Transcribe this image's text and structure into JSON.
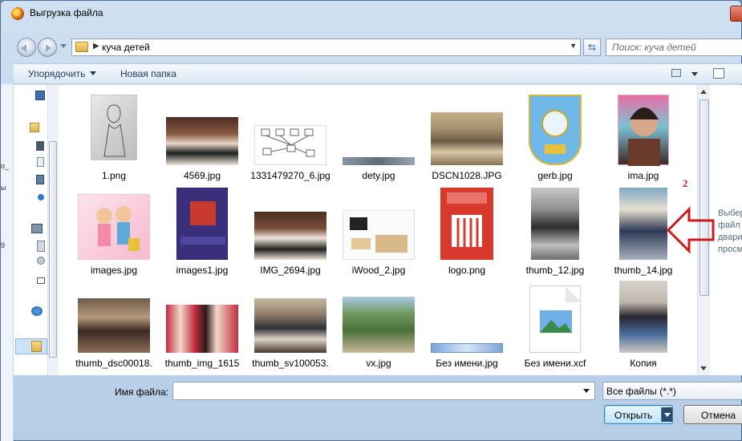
{
  "window": {
    "title": "Выгрузка файла",
    "close_color": "#c7432c"
  },
  "address_bar": {
    "path": "куча детей",
    "search_placeholder": "Поиск: куча детей"
  },
  "toolbar": {
    "organize_label": "Упорядочить",
    "new_folder_label": "Новая папка"
  },
  "files": [
    {
      "name": "1.png"
    },
    {
      "name": "4569.jpg"
    },
    {
      "name": "1331479270_6.jpg"
    },
    {
      "name": "dety.jpg"
    },
    {
      "name": "DSCN1028.JPG"
    },
    {
      "name": "gerb.jpg"
    },
    {
      "name": "ima.jpg"
    },
    {
      "name": "images.jpg"
    },
    {
      "name": "images1.jpg"
    },
    {
      "name": "IMG_2694.jpg"
    },
    {
      "name": "iWood_2.jpg"
    },
    {
      "name": "logo.png"
    },
    {
      "name": "thumb_12.jpg"
    },
    {
      "name": "thumb_14.jpg"
    },
    {
      "name": "thumb_dsc00018."
    },
    {
      "name": "thumb_img_1615"
    },
    {
      "name": "thumb_sv100053."
    },
    {
      "name": "vx.jpg"
    },
    {
      "name": "Без имени.jpg"
    },
    {
      "name": "Без имени.xcf"
    },
    {
      "name": "Копия"
    }
  ],
  "preview_pane": {
    "text_lines": [
      "Выбер",
      "файл",
      "дварит",
      "просм"
    ]
  },
  "annotation": {
    "number": "2",
    "color": "#d01a1a"
  },
  "bottom": {
    "filename_label": "Имя файла:",
    "filename_value": "",
    "filter_value": "Все файлы (*.*)",
    "open_label": "Открыть",
    "cancel_label": "Отмена"
  },
  "background": {
    "strip_texts": [
      "о_",
      "ы",
      "9"
    ]
  }
}
